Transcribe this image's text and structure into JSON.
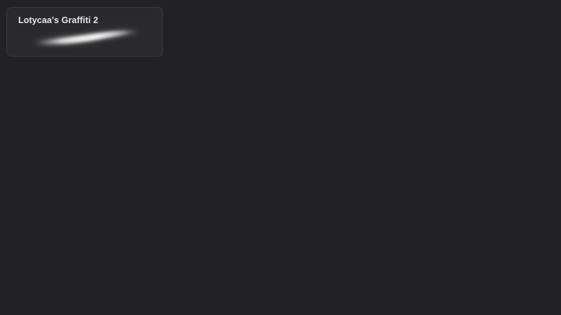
{
  "brush_library": {
    "items": [
      {
        "name": "Lotycaa's Graffiti 2",
        "stroke_preview": "soft-airbrush-stroke"
      }
    ]
  },
  "colors": {
    "background": "#222124",
    "card_background": "#2a292c",
    "card_border": "#39383c",
    "label_text": "#e6e6e8",
    "stroke": "#ffffff"
  }
}
